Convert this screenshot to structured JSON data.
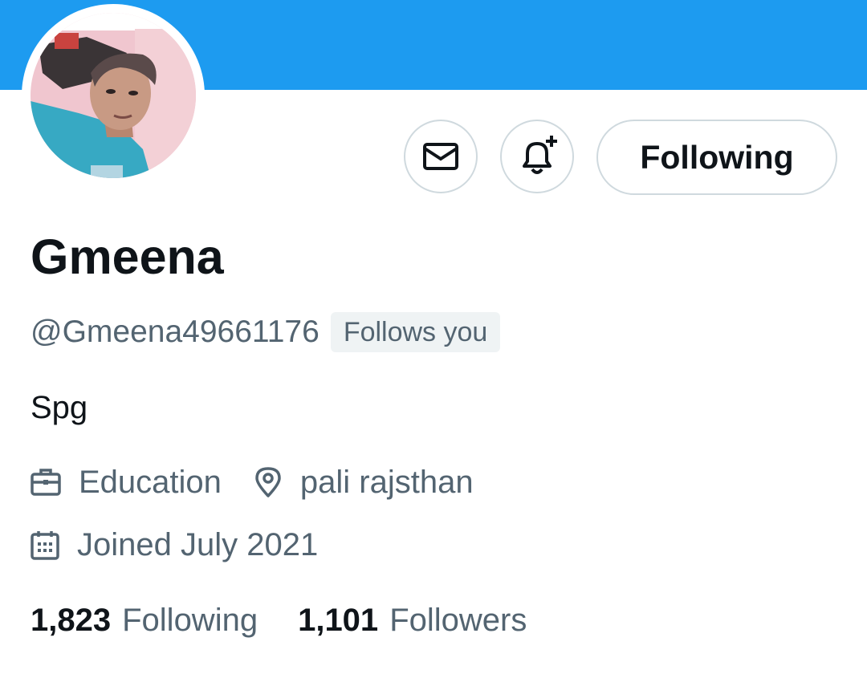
{
  "banner": {
    "color": "#1d9bf0"
  },
  "profile": {
    "avatar_name": "profile-photo",
    "display_name": "Gmeena",
    "handle": "@Gmeena49661176",
    "follows_you": "Follows you",
    "bio": "Spg",
    "category": "Education",
    "location": "pali rajsthan",
    "joined": "Joined July 2021"
  },
  "actions": {
    "message_icon": "envelope-icon",
    "notify_icon": "bell-plus-icon",
    "following_label": "Following"
  },
  "stats": {
    "following_count": "1,823",
    "following_label": "Following",
    "followers_count": "1,101",
    "followers_label": "Followers"
  },
  "colors": {
    "text_primary": "#0f1419",
    "text_secondary": "#536471",
    "border": "#cfd9de",
    "badge_bg": "#eff3f4"
  }
}
